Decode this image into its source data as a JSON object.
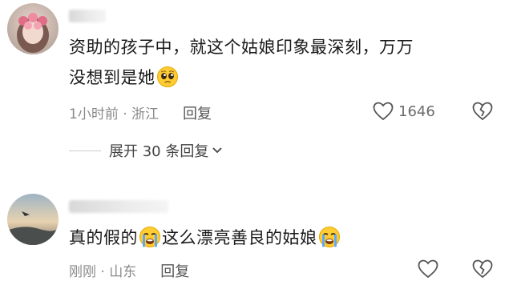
{
  "comments": [
    {
      "text_line1": "资助的孩子中，就这个姑娘印象最深刻，万万",
      "text_line2_a": "没想到是她",
      "emoji_1": "pleading-face-emoji",
      "time": "1小时前",
      "location": "浙江",
      "reply_label": "回复",
      "like_count": "1646",
      "expand_label": "展开 30 条回复"
    },
    {
      "text_a": "真的假的",
      "emoji_1": "crying-face-emoji",
      "text_b": "这么漂亮善良的姑娘",
      "emoji_2": "crying-face-emoji",
      "time": "刚刚",
      "location": "山东",
      "reply_label": "回复"
    }
  ],
  "meta_separator": " · "
}
